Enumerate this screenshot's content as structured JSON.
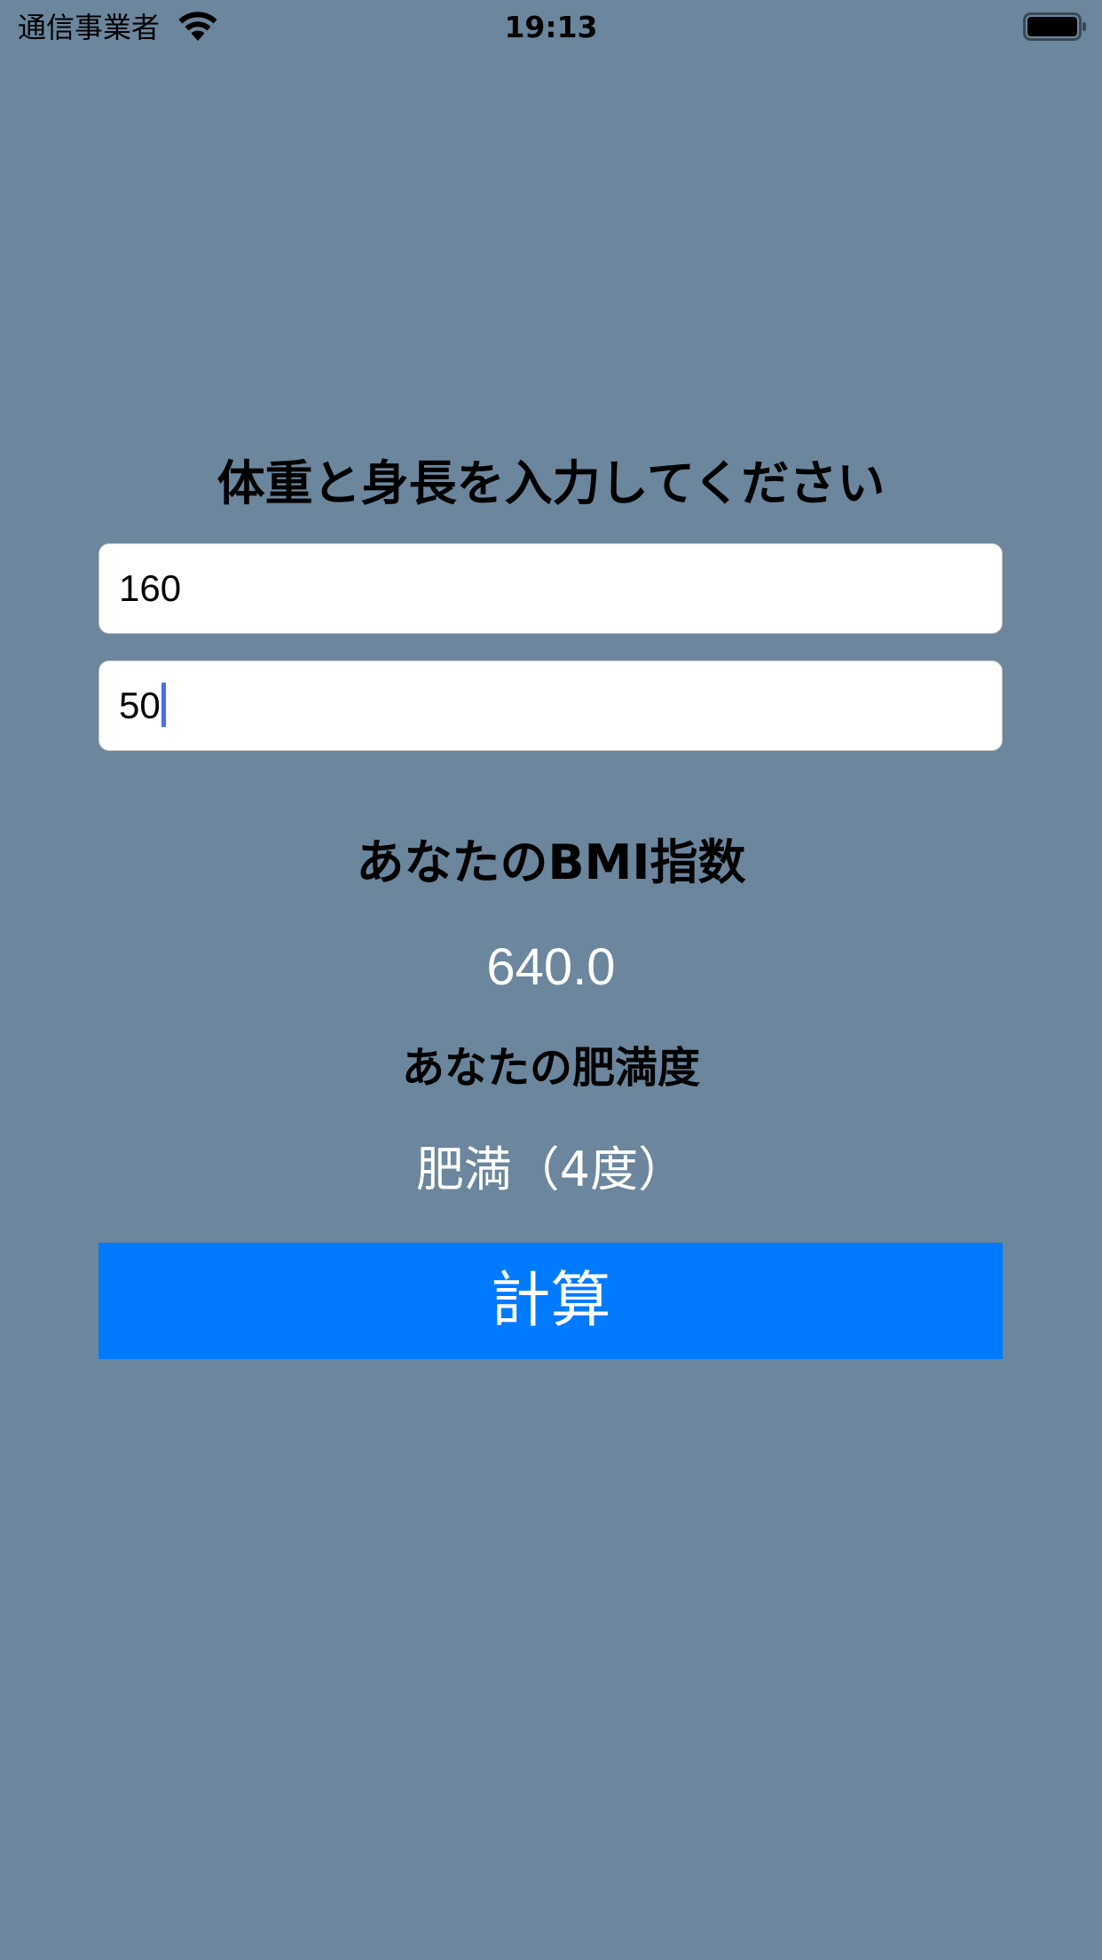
{
  "status_bar": {
    "carrier": "通信事業者",
    "time": "19:13",
    "wifi_icon": "wifi-icon",
    "battery_icon": "battery-icon"
  },
  "form": {
    "prompt": "体重と身長を入力してください",
    "input_1_value": "160",
    "input_2_value": "50"
  },
  "result": {
    "bmi_label": "あなたのBMI指数",
    "bmi_value": "640.0",
    "obesity_label": "あなたの肥満度",
    "obesity_value": "肥満（4度）"
  },
  "actions": {
    "calculate_label": "計算"
  },
  "colors": {
    "background": "#6b869d",
    "button": "#007aff",
    "caret": "#4b6fe8"
  }
}
